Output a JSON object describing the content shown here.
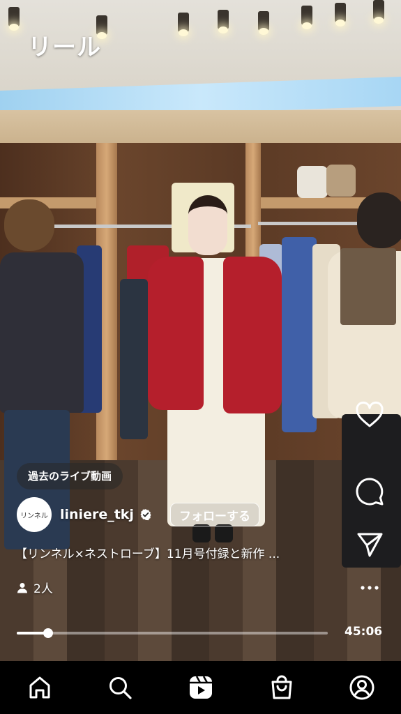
{
  "header": {
    "title": "リール"
  },
  "live": {
    "past_live_label": "過去のライブ動画"
  },
  "user": {
    "avatar_text": "リンネル",
    "username": "liniere_tkj",
    "follow_label": "フォローする"
  },
  "caption": "【リンネル×ネストローブ】11月号付録と新作 ...",
  "viewers": {
    "count_label": "2人"
  },
  "playback": {
    "duration": "45:06",
    "progress_fraction": 0.1
  },
  "side_actions": [
    "heart-icon",
    "comment-icon",
    "send-icon",
    "more-icon"
  ],
  "nav": [
    "home-icon",
    "search-icon",
    "reels-icon",
    "shop-icon",
    "profile-icon"
  ],
  "colors": {
    "background": "#000000",
    "text": "#ffffff",
    "verified_badge": "#ffffff"
  }
}
